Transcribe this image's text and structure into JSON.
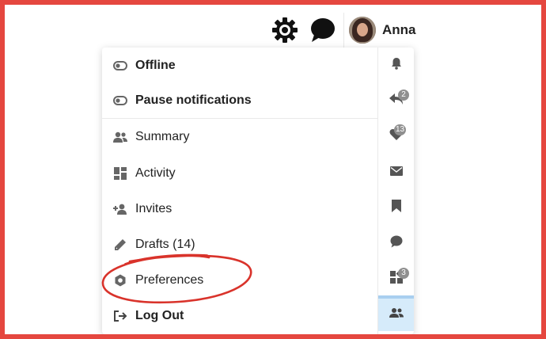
{
  "header": {
    "icons": [
      "gear-icon",
      "chat-bubble-icon"
    ],
    "user_name": "Anna"
  },
  "menu": {
    "items": [
      {
        "label": "Offline",
        "icon": "toggle-off-icon",
        "bold": true
      },
      {
        "label": "Pause notifications",
        "icon": "toggle-off-icon",
        "bold": true
      },
      {
        "label": "Summary",
        "icon": "users-icon",
        "bold": false
      },
      {
        "label": "Activity",
        "icon": "dashboard-icon",
        "bold": false
      },
      {
        "label": "Invites",
        "icon": "user-plus-icon",
        "bold": false
      },
      {
        "label": "Drafts (14)",
        "icon": "pencil-icon",
        "bold": false
      },
      {
        "label": "Preferences",
        "icon": "hex-cog-icon",
        "bold": false
      },
      {
        "label": "Log Out",
        "icon": "sign-out-icon",
        "bold": true
      }
    ]
  },
  "rail": {
    "buttons": [
      {
        "icon": "bell-icon",
        "badge": ""
      },
      {
        "icon": "reply-icon",
        "badge": "2"
      },
      {
        "icon": "heart-icon",
        "badge": "13"
      },
      {
        "icon": "envelope-icon",
        "badge": ""
      },
      {
        "icon": "bookmark-icon",
        "badge": ""
      },
      {
        "icon": "comment-icon",
        "badge": ""
      },
      {
        "icon": "widgets-icon",
        "badge": "3"
      },
      {
        "icon": "user-group-icon",
        "badge": "",
        "active": true
      }
    ]
  },
  "colors": {
    "frame_border": "#e5473f",
    "annotation": "#d9332b",
    "active_rail": "#d6ebfa",
    "badge": "#8f8f8f"
  }
}
